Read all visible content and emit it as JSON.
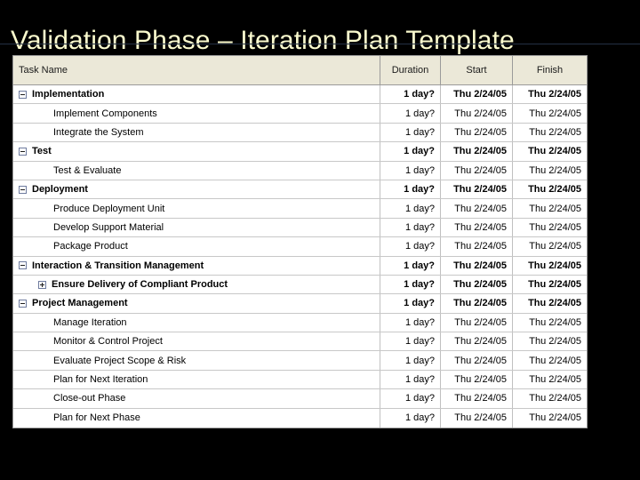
{
  "slide": {
    "title": "Validation Phase – Iteration Plan Template"
  },
  "table": {
    "columns": {
      "name": "Task Name",
      "duration": "Duration",
      "start": "Start",
      "finish": "Finish"
    },
    "rows": [
      {
        "name": "Implementation",
        "level": 0,
        "toggle": "minus",
        "summary": true,
        "duration": "1 day?",
        "start": "Thu 2/24/05",
        "finish": "Thu 2/24/05"
      },
      {
        "name": "Implement Components",
        "level": 1,
        "toggle": "none",
        "summary": false,
        "duration": "1 day?",
        "start": "Thu 2/24/05",
        "finish": "Thu 2/24/05"
      },
      {
        "name": "Integrate the System",
        "level": 1,
        "toggle": "none",
        "summary": false,
        "duration": "1 day?",
        "start": "Thu 2/24/05",
        "finish": "Thu 2/24/05"
      },
      {
        "name": "Test",
        "level": 0,
        "toggle": "minus",
        "summary": true,
        "duration": "1 day?",
        "start": "Thu 2/24/05",
        "finish": "Thu 2/24/05"
      },
      {
        "name": "Test & Evaluate",
        "level": 1,
        "toggle": "none",
        "summary": false,
        "duration": "1 day?",
        "start": "Thu 2/24/05",
        "finish": "Thu 2/24/05"
      },
      {
        "name": "Deployment",
        "level": 0,
        "toggle": "minus",
        "summary": true,
        "duration": "1 day?",
        "start": "Thu 2/24/05",
        "finish": "Thu 2/24/05"
      },
      {
        "name": "Produce Deployment Unit",
        "level": 1,
        "toggle": "none",
        "summary": false,
        "duration": "1 day?",
        "start": "Thu 2/24/05",
        "finish": "Thu 2/24/05"
      },
      {
        "name": "Develop Support Material",
        "level": 1,
        "toggle": "none",
        "summary": false,
        "duration": "1 day?",
        "start": "Thu 2/24/05",
        "finish": "Thu 2/24/05"
      },
      {
        "name": "Package Product",
        "level": 1,
        "toggle": "none",
        "summary": false,
        "duration": "1 day?",
        "start": "Thu 2/24/05",
        "finish": "Thu 2/24/05"
      },
      {
        "name": "Interaction & Transition Management",
        "level": 0,
        "toggle": "minus",
        "summary": true,
        "duration": "1 day?",
        "start": "Thu 2/24/05",
        "finish": "Thu 2/24/05"
      },
      {
        "name": "Ensure Delivery of Compliant Product",
        "level": 1,
        "toggle": "plus",
        "summary": true,
        "duration": "1 day?",
        "start": "Thu 2/24/05",
        "finish": "Thu 2/24/05"
      },
      {
        "name": "Project Management",
        "level": 0,
        "toggle": "minus",
        "summary": true,
        "duration": "1 day?",
        "start": "Thu 2/24/05",
        "finish": "Thu 2/24/05"
      },
      {
        "name": "Manage Iteration",
        "level": 1,
        "toggle": "none",
        "summary": false,
        "duration": "1 day?",
        "start": "Thu 2/24/05",
        "finish": "Thu 2/24/05"
      },
      {
        "name": "Monitor & Control Project",
        "level": 1,
        "toggle": "none",
        "summary": false,
        "duration": "1 day?",
        "start": "Thu 2/24/05",
        "finish": "Thu 2/24/05"
      },
      {
        "name": "Evaluate Project Scope & Risk",
        "level": 1,
        "toggle": "none",
        "summary": false,
        "duration": "1 day?",
        "start": "Thu 2/24/05",
        "finish": "Thu 2/24/05"
      },
      {
        "name": "Plan for Next Iteration",
        "level": 1,
        "toggle": "none",
        "summary": false,
        "duration": "1 day?",
        "start": "Thu 2/24/05",
        "finish": "Thu 2/24/05"
      },
      {
        "name": "Close-out Phase",
        "level": 1,
        "toggle": "none",
        "summary": false,
        "duration": "1 day?",
        "start": "Thu 2/24/05",
        "finish": "Thu 2/24/05"
      },
      {
        "name": "Plan for Next Phase",
        "level": 1,
        "toggle": "none",
        "summary": false,
        "duration": "1 day?",
        "start": "Thu 2/24/05",
        "finish": "Thu 2/24/05"
      }
    ]
  },
  "colors": {
    "slide_background": "#000000",
    "title_text": "#FBFBCE",
    "table_header_background": "#EBE8D8",
    "table_background": "#FFFFFF",
    "gridline": "#C8C8C8",
    "toggle_border": "#6E7B9E",
    "rule": "#2D4763"
  }
}
